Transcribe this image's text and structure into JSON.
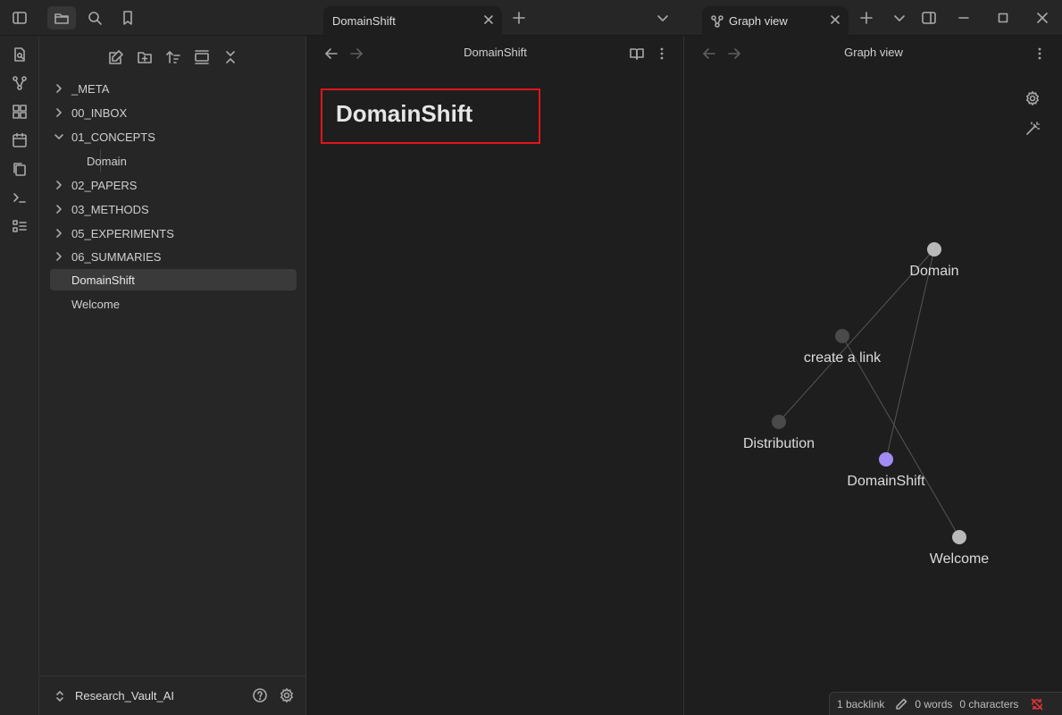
{
  "titlebar": {
    "tabs": [
      {
        "label": "DomainShift"
      },
      {
        "label": "Graph view"
      }
    ]
  },
  "sidebar": {
    "tree": [
      {
        "label": "_META",
        "type": "folder",
        "expanded": false
      },
      {
        "label": "00_INBOX",
        "type": "folder",
        "expanded": false
      },
      {
        "label": "01_CONCEPTS",
        "type": "folder",
        "expanded": true
      },
      {
        "label": "Domain",
        "type": "file"
      },
      {
        "label": "02_PAPERS",
        "type": "folder",
        "expanded": false
      },
      {
        "label": "03_METHODS",
        "type": "folder",
        "expanded": false
      },
      {
        "label": "05_EXPERIMENTS",
        "type": "folder",
        "expanded": false
      },
      {
        "label": "06_SUMMARIES",
        "type": "folder",
        "expanded": false
      },
      {
        "label": "DomainShift",
        "type": "file",
        "active": true
      },
      {
        "label": "Welcome",
        "type": "file"
      }
    ],
    "vault_name": "Research_Vault_AI"
  },
  "note_pane": {
    "header_title": "DomainShift",
    "heading": "DomainShift"
  },
  "graph_pane": {
    "header_title": "Graph view",
    "nodes": [
      {
        "id": "domain",
        "label": "Domain",
        "color": "#b9b9b9"
      },
      {
        "id": "create",
        "label": "create a link",
        "color": "#4a4a4a"
      },
      {
        "id": "distribution",
        "label": "Distribution",
        "color": "#4a4a4a"
      },
      {
        "id": "domainshift",
        "label": "DomainShift",
        "color": "#a38bf5"
      },
      {
        "id": "welcome",
        "label": "Welcome",
        "color": "#b9b9b9"
      }
    ],
    "edges": [
      [
        "domain",
        "distribution"
      ],
      [
        "domain",
        "domainshift"
      ],
      [
        "create",
        "welcome"
      ]
    ]
  },
  "status_bar": {
    "backlinks": "1 backlink",
    "words": "0 words",
    "characters": "0 characters"
  },
  "colors": {
    "accent": "#a38bf5",
    "highlight_box": "#e0141b",
    "sync_error": "#e0333a"
  }
}
